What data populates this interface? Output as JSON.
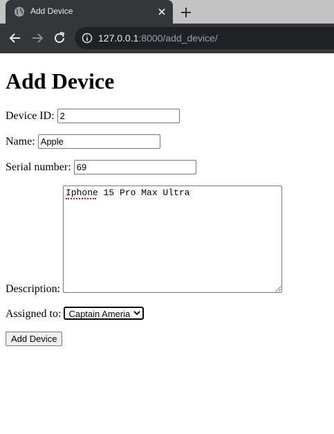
{
  "browser": {
    "tab_title": "Add Device",
    "url_host": "127.0.0.1",
    "url_rest": ":8000/add_device/"
  },
  "page": {
    "heading": "Add Device",
    "form": {
      "device_id_label": "Device ID:",
      "device_id_value": "2",
      "name_label": "Name:",
      "name_value": "Apple",
      "serial_label": "Serial number:",
      "serial_value": "69",
      "description_label": "Description:",
      "description_value": "Iphone 15 Pro Max Ultra",
      "assigned_label": "Assigned to:",
      "assigned_value": "Captain Ameria",
      "submit_label": "Add Device"
    }
  },
  "icons": [
    "globe-icon",
    "close-icon",
    "plus-icon",
    "back-arrow-icon",
    "forward-arrow-icon",
    "reload-icon",
    "info-icon"
  ],
  "colors": {
    "tabstrip_bg": "#c3c3c3",
    "toolbar_bg": "#35363a",
    "omnibox_bg": "#202124",
    "url_host": "#e8eaed",
    "url_rest": "#9aa0a6"
  }
}
